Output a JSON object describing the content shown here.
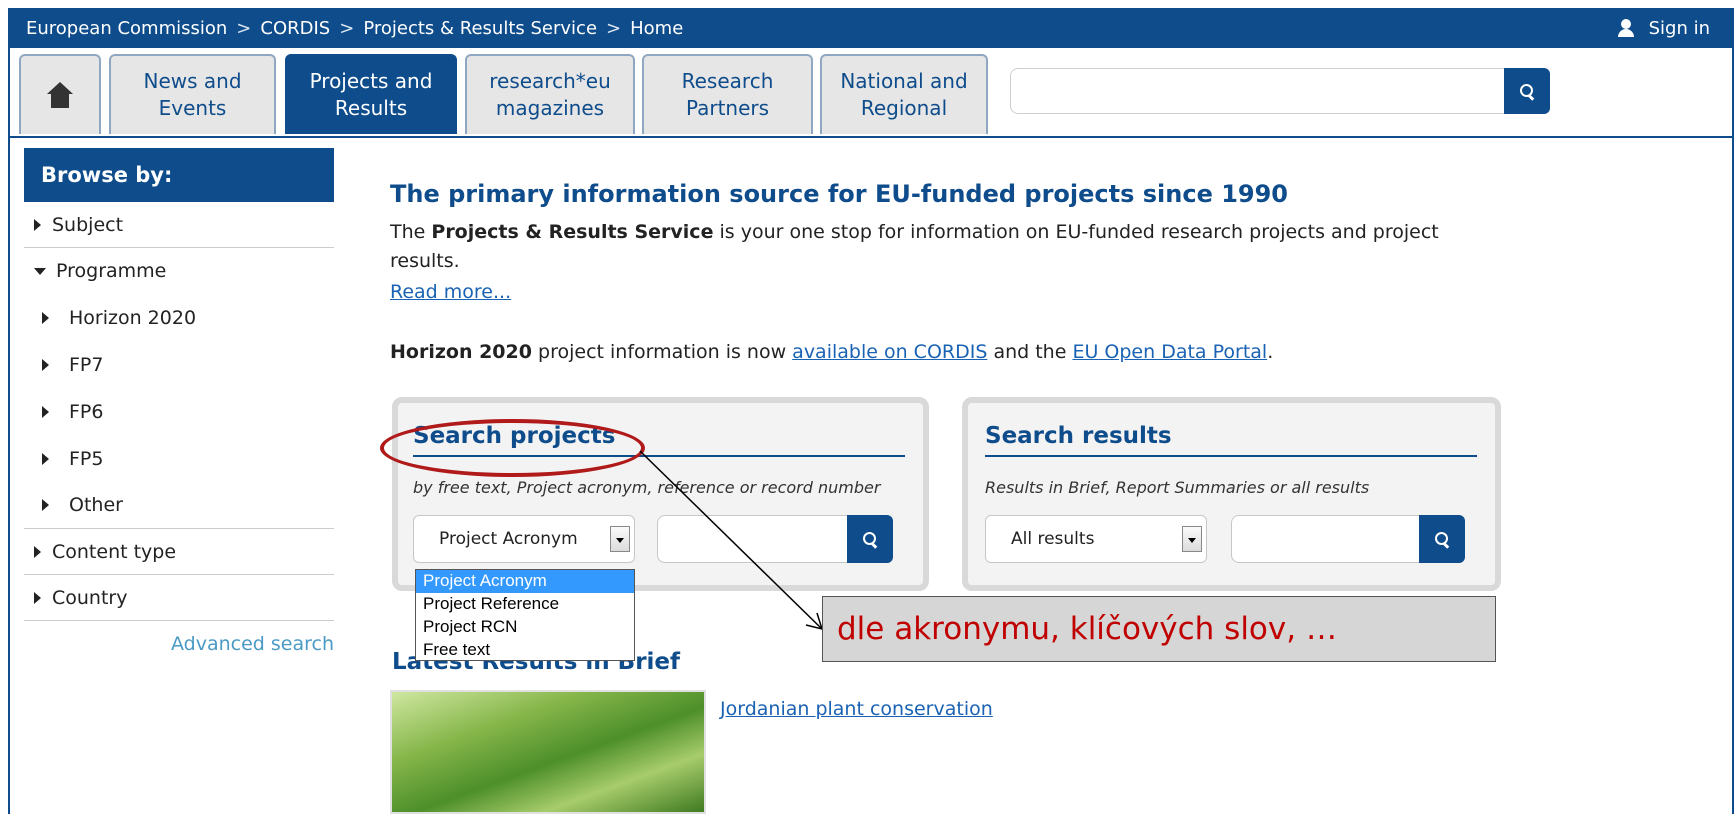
{
  "topbar": {
    "breadcrumb": [
      "European Commission",
      "CORDIS",
      "Projects & Results Service",
      "Home"
    ],
    "separator": ">",
    "sign_in": "Sign in"
  },
  "nav": {
    "tabs": [
      {
        "line1": "News and",
        "line2": "Events"
      },
      {
        "line1": "Projects and",
        "line2": "Results"
      },
      {
        "line1": "research*eu",
        "line2": "magazines"
      },
      {
        "line1": "Research",
        "line2": "Partners"
      },
      {
        "line1": "National and",
        "line2": "Regional"
      }
    ],
    "search_value": ""
  },
  "sidebar": {
    "title": "Browse by:",
    "items": [
      "Subject",
      "Programme"
    ],
    "programme_sub": [
      "Horizon 2020",
      "FP7",
      "FP6",
      "FP5",
      "Other"
    ],
    "items2": [
      "Content type",
      "Country"
    ],
    "advanced": "Advanced search"
  },
  "main": {
    "headline": "The primary information source for EU-funded projects since 1990",
    "intro_pre": "The ",
    "intro_bold": "Projects & Results Service",
    "intro_post": " is your one stop for information on EU-funded research projects and project results.",
    "read_more": "Read more...",
    "h2020_bold": "Horizon 2020",
    "h2020_mid": " project information is now ",
    "h2020_link1": "available on CORDIS",
    "h2020_and": " and the ",
    "h2020_link2": "EU Open Data Portal",
    "h2020_end": "."
  },
  "search_projects": {
    "title": "Search projects",
    "subtitle": "by free text, Project acronym, reference or record number",
    "selected": "Project Acronym",
    "options": [
      "Project Acronym",
      "Project Reference",
      "Project RCN",
      "Free text"
    ],
    "query": ""
  },
  "search_results": {
    "title": "Search results",
    "subtitle": "Results in Brief, Report Summaries or all results",
    "selected": "All results",
    "query": ""
  },
  "latest": {
    "title": "Latest Results in Brief",
    "first_link": "Jordanian plant conservation"
  },
  "annotation": {
    "text": "dle akronymu, klíčových slov, …",
    "color": "#c00000"
  },
  "colors": {
    "brand": "#0e4c8b",
    "link": "#1a63b4",
    "highlight": "#3399ff"
  }
}
